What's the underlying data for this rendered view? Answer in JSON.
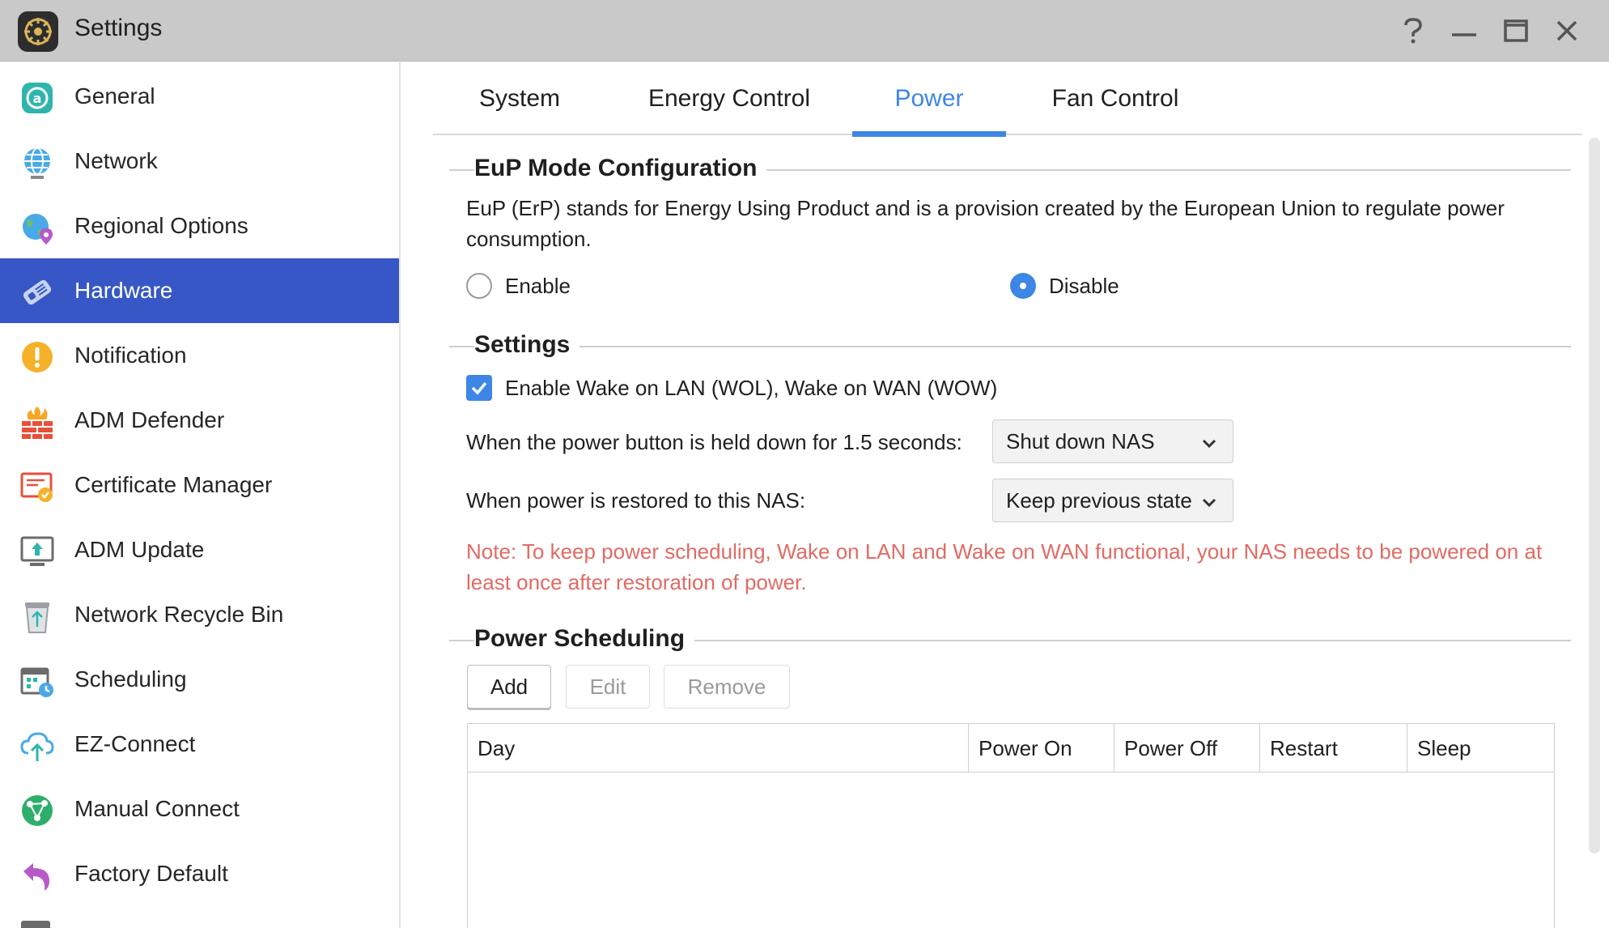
{
  "window": {
    "title": "Settings",
    "controls": [
      "help-icon",
      "minimize-icon",
      "maximize-icon",
      "close-icon"
    ]
  },
  "sidebar": {
    "items": [
      {
        "label": "General",
        "icon": "general-icon",
        "active": false
      },
      {
        "label": "Network",
        "icon": "globe-icon",
        "active": false
      },
      {
        "label": "Regional Options",
        "icon": "regional-globe-icon",
        "active": false
      },
      {
        "label": "Hardware",
        "icon": "hardware-icon",
        "active": true
      },
      {
        "label": "Notification",
        "icon": "exclamation-icon",
        "active": false
      },
      {
        "label": "ADM Defender",
        "icon": "firewall-icon",
        "active": false
      },
      {
        "label": "Certificate Manager",
        "icon": "certificate-icon",
        "active": false
      },
      {
        "label": "ADM Update",
        "icon": "update-icon",
        "active": false
      },
      {
        "label": "Network Recycle Bin",
        "icon": "recycle-bin-icon",
        "active": false
      },
      {
        "label": "Scheduling",
        "icon": "calendar-clock-icon",
        "active": false
      },
      {
        "label": "EZ-Connect",
        "icon": "cloud-upload-icon",
        "active": false
      },
      {
        "label": "Manual Connect",
        "icon": "network-sphere-icon",
        "active": false
      },
      {
        "label": "Factory Default",
        "icon": "undo-arrow-icon",
        "active": false
      }
    ]
  },
  "tabs": [
    {
      "label": "System",
      "active": false
    },
    {
      "label": "Energy Control",
      "active": false
    },
    {
      "label": "Power",
      "active": true
    },
    {
      "label": "Fan Control",
      "active": false
    }
  ],
  "eup": {
    "title": "EuP Mode Configuration",
    "description_line1": "EuP (ErP) stands for Energy Using Product and is a provision created by the European Union to regulate power",
    "description_line2": "consumption.",
    "enable_label": "Enable",
    "disable_label": "Disable",
    "selected": "Disable"
  },
  "settings": {
    "title": "Settings",
    "wol_label": "Enable Wake on LAN (WOL), Wake on WAN (WOW)",
    "wol_checked": true,
    "power_button_label": "When the power button is held down for 1.5 seconds:",
    "power_button_value": "Shut down NAS",
    "power_restore_label": "When power is restored to this NAS:",
    "power_restore_value": "Keep previous state",
    "note_line1": "Note: To keep power scheduling, Wake on LAN and Wake on WAN functional, your NAS needs to be powered on at",
    "note_line2": "least once after restoration of power.",
    "note_color": "#e06b63"
  },
  "scheduling": {
    "title": "Power Scheduling",
    "add_label": "Add",
    "edit_label": "Edit",
    "remove_label": "Remove",
    "columns": [
      "Day",
      "Power On",
      "Power Off",
      "Restart",
      "Sleep"
    ],
    "rows": []
  },
  "colors": {
    "accent": "#3d86e6",
    "sidebar_active": "#3657c5",
    "titlebar": "#c9c9c9"
  }
}
